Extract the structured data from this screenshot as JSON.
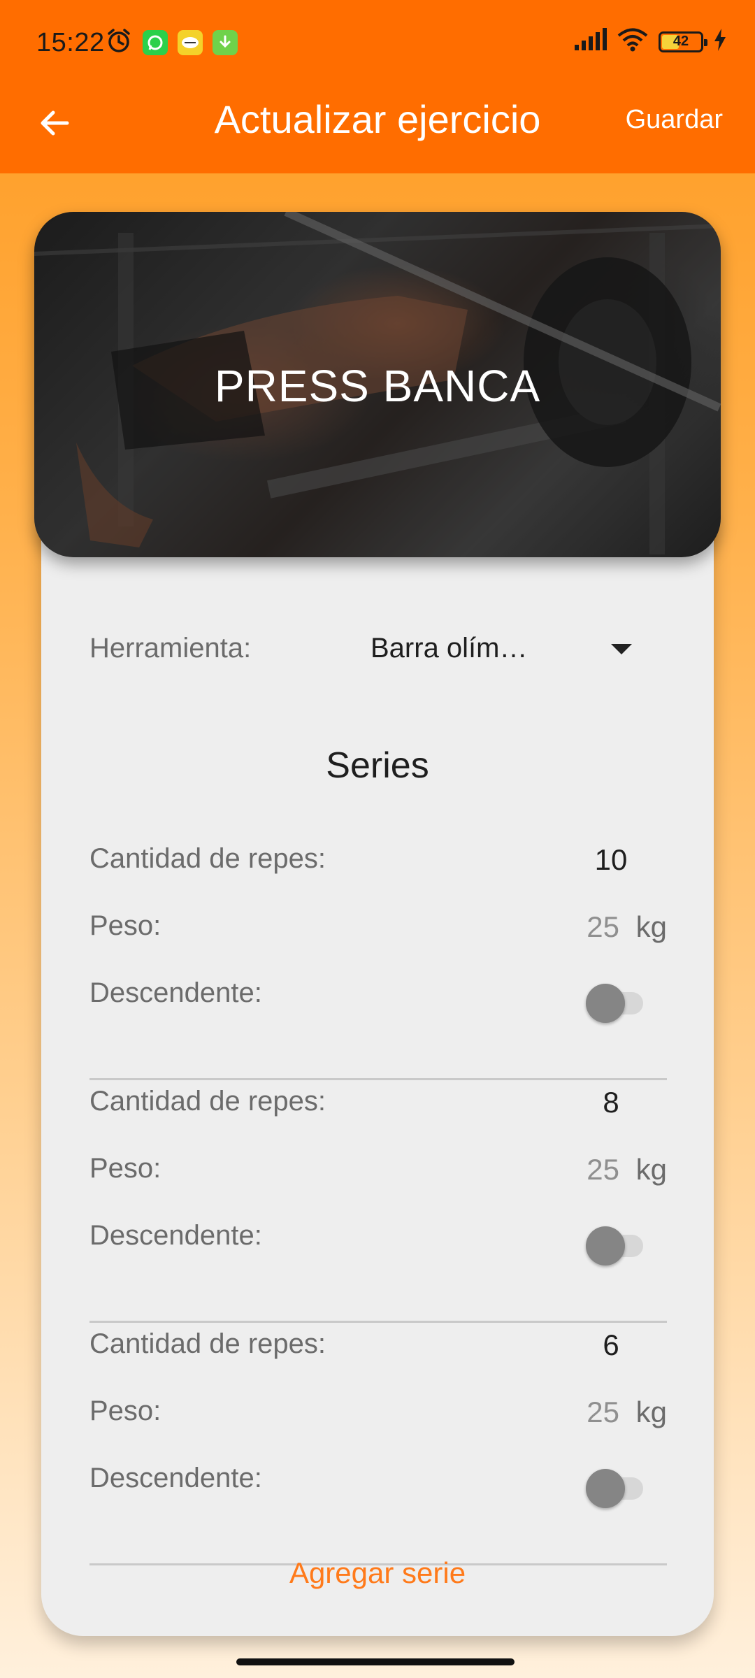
{
  "status_bar": {
    "time": "15:22",
    "battery_level": "42",
    "icons": [
      "alarm-icon",
      "whatsapp-icon",
      "notification-app-icon",
      "download-icon",
      "signal-icon",
      "wifi-icon",
      "battery-icon",
      "charging-icon"
    ]
  },
  "app_bar": {
    "title": "Actualizar ejercicio",
    "save_label": "Guardar"
  },
  "exercise": {
    "name": "PRESS BANCA",
    "tool_label": "Herramienta:",
    "tool_value": "Barra olím…"
  },
  "series_title": "Series",
  "sets": [
    {
      "reps_label": "Cantidad de repes:",
      "reps": "10",
      "weight_label": "Peso:",
      "weight": "25",
      "unit": "kg",
      "descending_label": "Descendente:"
    },
    {
      "reps_label": "Cantidad de repes:",
      "reps": "8",
      "weight_label": "Peso:",
      "weight": "25",
      "unit": "kg",
      "descending_label": "Descendente:"
    },
    {
      "reps_label": "Cantidad de repes:",
      "reps": "6",
      "weight_label": "Peso:",
      "weight": "25",
      "unit": "kg",
      "descending_label": "Descendente:"
    }
  ],
  "add_set_label": "Agregar serie",
  "colors": {
    "primary": "#ff6d00",
    "accent_text": "#ff7a1a",
    "card": "#eeeeee"
  }
}
